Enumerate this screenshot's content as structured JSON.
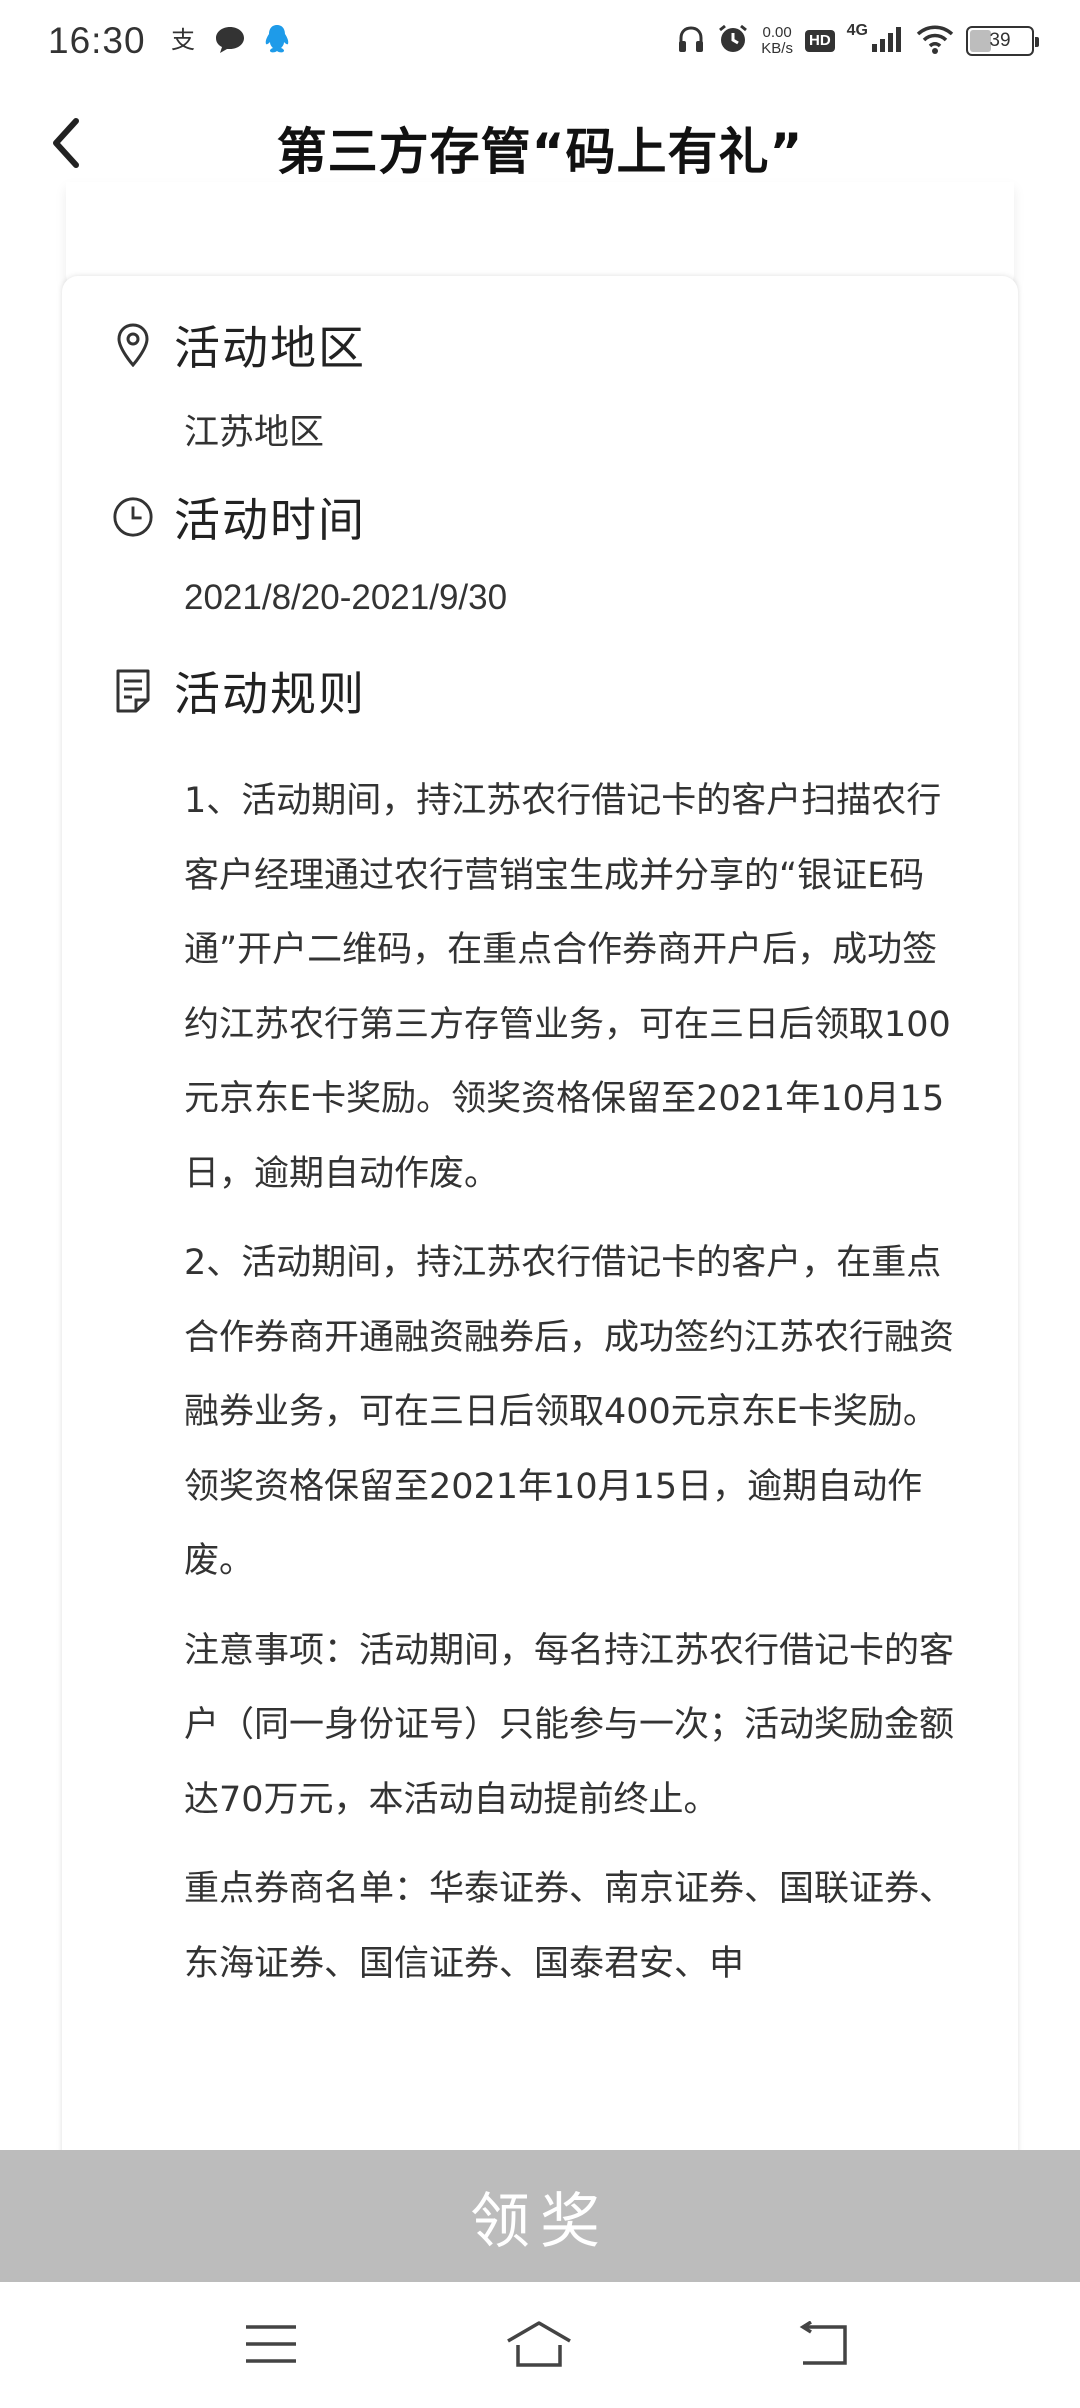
{
  "status_bar": {
    "time": "16:30",
    "net_speed_value": "0.00",
    "net_speed_unit": "KB/s",
    "hd": "HD",
    "network": "4G",
    "battery": "39",
    "battery_level_percent": 39,
    "icons": [
      "alipay-icon",
      "message-icon",
      "qq-icon",
      "headphones-icon",
      "alarm-icon",
      "signal-icon",
      "wifi-icon",
      "battery-icon"
    ]
  },
  "header": {
    "title": "第三方存管“码上有礼”",
    "back_icon": "chevron-left-icon"
  },
  "sections": {
    "region": {
      "title": "活动地区",
      "value": "江苏地区",
      "icon": "location-pin-icon"
    },
    "time": {
      "title": "活动时间",
      "value": "2021/8/20-2021/9/30",
      "icon": "clock-icon"
    },
    "rules": {
      "title": "活动规则",
      "icon": "document-icon",
      "paragraphs": [
        "1、活动期间，持江苏农行借记卡的客户扫描农行客户经理通过农行营销宝生成并分享的“银证E码通”开户二维码，在重点合作券商开户后，成功签约江苏农行第三方存管业务，可在三日后领取100元京东E卡奖励。领奖资格保留至2021年10月15日，逾期自动作废。",
        "2、活动期间，持江苏农行借记卡的客户，在重点合作券商开通融资融券后，成功签约江苏农行融资融券业务，可在三日后领取400元京东E卡奖励。领奖资格保留至2021年10月15日，逾期自动作废。",
        "注意事项：活动期间，每名持江苏农行借记卡的客户（同一身份证号）只能参与一次；活动奖励金额达70万元，本活动自动提前终止。",
        "重点券商名单：华泰证券、南京证券、国联证券、东海证券、国信证券、国泰君安、申"
      ]
    }
  },
  "claim_button": {
    "label": "领奖"
  },
  "nav_bar": {
    "icons": [
      "menu-icon",
      "home-icon",
      "back-nav-icon"
    ]
  },
  "colors": {
    "claim_button_bg": "#bcbcbc",
    "text": "#333333",
    "title": "#111111"
  }
}
